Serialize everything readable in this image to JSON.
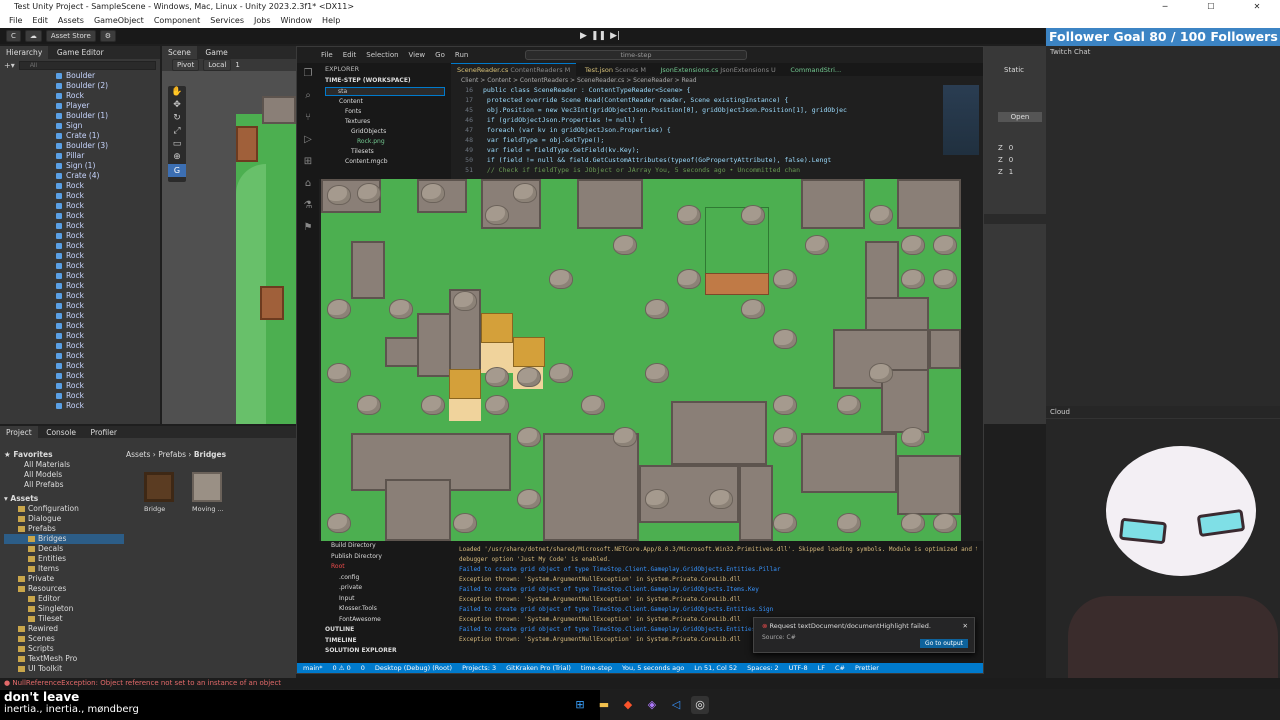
{
  "window": {
    "title": "Test Unity Project - SampleScene - Windows, Mac, Linux - Unity 2023.2.3f1* <DX11>"
  },
  "menubar": [
    "File",
    "Edit",
    "Assets",
    "GameObject",
    "Component",
    "Services",
    "Jobs",
    "Window",
    "Help"
  ],
  "toolbar": {
    "account": "C",
    "asset_store": "Asset Store",
    "pivot": "Pivot",
    "local": "Local",
    "page": "1"
  },
  "hierarchy": {
    "tabs": [
      "Hierarchy",
      "Game Editor"
    ],
    "search_placeholder": "All",
    "items": [
      "Boulder",
      "Boulder (2)",
      "Rock",
      "Player",
      "Boulder (1)",
      "Sign",
      "Crate (1)",
      "Boulder (3)",
      "Pillar",
      "Sign (1)",
      "Crate (4)",
      "Rock",
      "Rock",
      "Rock",
      "Rock",
      "Rock",
      "Rock",
      "Rock",
      "Rock",
      "Rock",
      "Rock",
      "Rock",
      "Rock",
      "Rock",
      "Rock",
      "Rock",
      "Rock",
      "Rock",
      "Rock",
      "Rock",
      "Rock",
      "Rock",
      "Rock",
      "Rock"
    ]
  },
  "scene_tabs": [
    "Scene",
    "Game"
  ],
  "project": {
    "tabs": [
      "Project",
      "Console",
      "Profiler"
    ],
    "favorites_label": "Favorites",
    "favorites": [
      "All Materials",
      "All Models",
      "All Prefabs"
    ],
    "assets_label": "Assets",
    "tree": [
      "Configuration",
      "Dialogue",
      "Prefabs",
      "Bridges",
      "Decals",
      "Entities",
      "Items",
      "Private",
      "Resources",
      "Editor",
      "Singleton",
      "Tileset",
      "Rewired",
      "Scenes",
      "Scripts",
      "TextMesh Pro",
      "UI Toolkit"
    ],
    "breadcrumb": [
      "Assets",
      "Prefabs",
      "Bridges"
    ],
    "files": [
      "Bridge",
      "Moving ..."
    ]
  },
  "vscode": {
    "menu": [
      "File",
      "Edit",
      "Selection",
      "View",
      "Go",
      "Run"
    ],
    "search": "time-step",
    "explorer_title": "EXPLORER",
    "workspace": "TIME-STEP (WORKSPACE)",
    "filter": "sta",
    "explorer_items": [
      "Content",
      "Fonts",
      "Textures",
      "GridObjects",
      "Rock.png",
      "Tilesets",
      "Content.mgcb"
    ],
    "tabs": [
      "SceneReader.cs",
      "Test.json",
      "JsonExtensions.cs",
      "CommandStri..."
    ],
    "tab_details": [
      "ContentReaders M",
      "Scenes M",
      "JsonExtensions U",
      ""
    ],
    "breadcrumb": "Client > Content > ContentReaders > SceneReader.cs > SceneReader > Read",
    "code": [
      {
        "n": "16",
        "t": "public class SceneReader : ContentTypeReader<Scene> {"
      },
      {
        "n": "17",
        "t": "    protected override Scene Read(ContentReader reader, Scene existingInstance) {"
      },
      {
        "n": "45",
        "t": "            obj.Position = new Vec3Int(gridObjectJson.Position[0], gridObjectJson.Position[1], gridObjec"
      },
      {
        "n": "46",
        "t": "            if (gridObjectJson.Properties != null) {"
      },
      {
        "n": "47",
        "t": "              foreach (var kv in gridObjectJson.Properties) {"
      },
      {
        "n": "48",
        "t": "                var fieldType = obj.GetType();"
      },
      {
        "n": "49",
        "t": "                var field = fieldType.GetField(kv.Key);"
      },
      {
        "n": "50",
        "t": "                if (field != null && field.GetCustomAttributes(typeof(GoPropertyAttribute), false).Lengt"
      },
      {
        "n": "51",
        "t": "                  // Check if fieldType is JObject or JArray     You, 5 seconds ago • Uncommitted chan"
      }
    ],
    "bottom_explorer": [
      "Build Directory",
      "Publish Directory",
      "Root",
      ".config",
      ".private",
      "Input",
      "Klosser.Tools",
      "FontAwesome",
      "OUTLINE",
      "TIMELINE",
      "SOLUTION EXPLORER"
    ],
    "terminal": [
      {
        "t": "Loaded '/usr/share/dotnet/shared/Microsoft.NETCore.App/8.0.3/Microsoft.Win32.Primitives.dll'. Skipped loading symbols. Module is optimized and the",
        "c": "#d7ba7d"
      },
      {
        "t": "debugger option 'Just My Code' is enabled.",
        "c": "#d7ba7d"
      },
      {
        "t": "Failed to create grid object of type TimeStop.Client.Gameplay.GridObjects.Entities.Pillar",
        "c": "#3794ff"
      },
      {
        "t": "Exception thrown: 'System.ArgumentNullException' in System.Private.CoreLib.dll",
        "c": "#d7ba7d"
      },
      {
        "t": "Failed to create grid object of type TimeStop.Client.Gameplay.GridObjects.Items.Key",
        "c": "#3794ff"
      },
      {
        "t": "Exception thrown: 'System.ArgumentNullException' in System.Private.CoreLib.dll",
        "c": "#d7ba7d"
      },
      {
        "t": "Failed to create grid object of type TimeStop.Client.Gameplay.GridObjects.Entities.Sign",
        "c": "#3794ff"
      },
      {
        "t": "Exception thrown: 'System.ArgumentNullException' in System.Private.CoreLib.dll",
        "c": "#d7ba7d"
      },
      {
        "t": "Failed to create grid object of type TimeStop.Client.Gameplay.GridObjects.Entities",
        "c": "#3794ff"
      },
      {
        "t": "Exception thrown: 'System.ArgumentNullException' in System.Private.CoreLib.dll",
        "c": "#d7ba7d"
      }
    ],
    "toast": {
      "message": "Request textDocument/documentHighlight failed.",
      "source": "Source: C#",
      "button": "Go to output"
    },
    "status": [
      "main*",
      "0 ⚠ 0",
      "0",
      "Desktop (Debug) (Root)",
      "Projects: 3",
      "GitKraken Pro (Trial)",
      "time-step",
      "You, 5 seconds ago",
      "Ln 51, Col 52",
      "Spaces: 2",
      "UTF-8",
      "LF",
      "C#",
      "Prettier"
    ]
  },
  "inspector": {
    "static_label": "Static",
    "open_button": "Open",
    "transform": [
      {
        "axis": "Z",
        "value": "0"
      },
      {
        "axis": "Z",
        "value": "0"
      },
      {
        "axis": "Z",
        "value": "1"
      }
    ]
  },
  "stream": {
    "goal": "Follower Goal     80 / 100 Followers",
    "chat_label": "Twitch Chat",
    "cloud_label": "Cloud"
  },
  "console_error": "NullReferenceException: Object reference not set to an instance of an object",
  "caption": {
    "line1": "don't leave",
    "line2": "inertia., inertia., møndberg"
  },
  "colors": {
    "accent": "#007acc",
    "grass": "#4caf50",
    "goal_bg": "#3c84c4",
    "error": "#e36a6a"
  }
}
